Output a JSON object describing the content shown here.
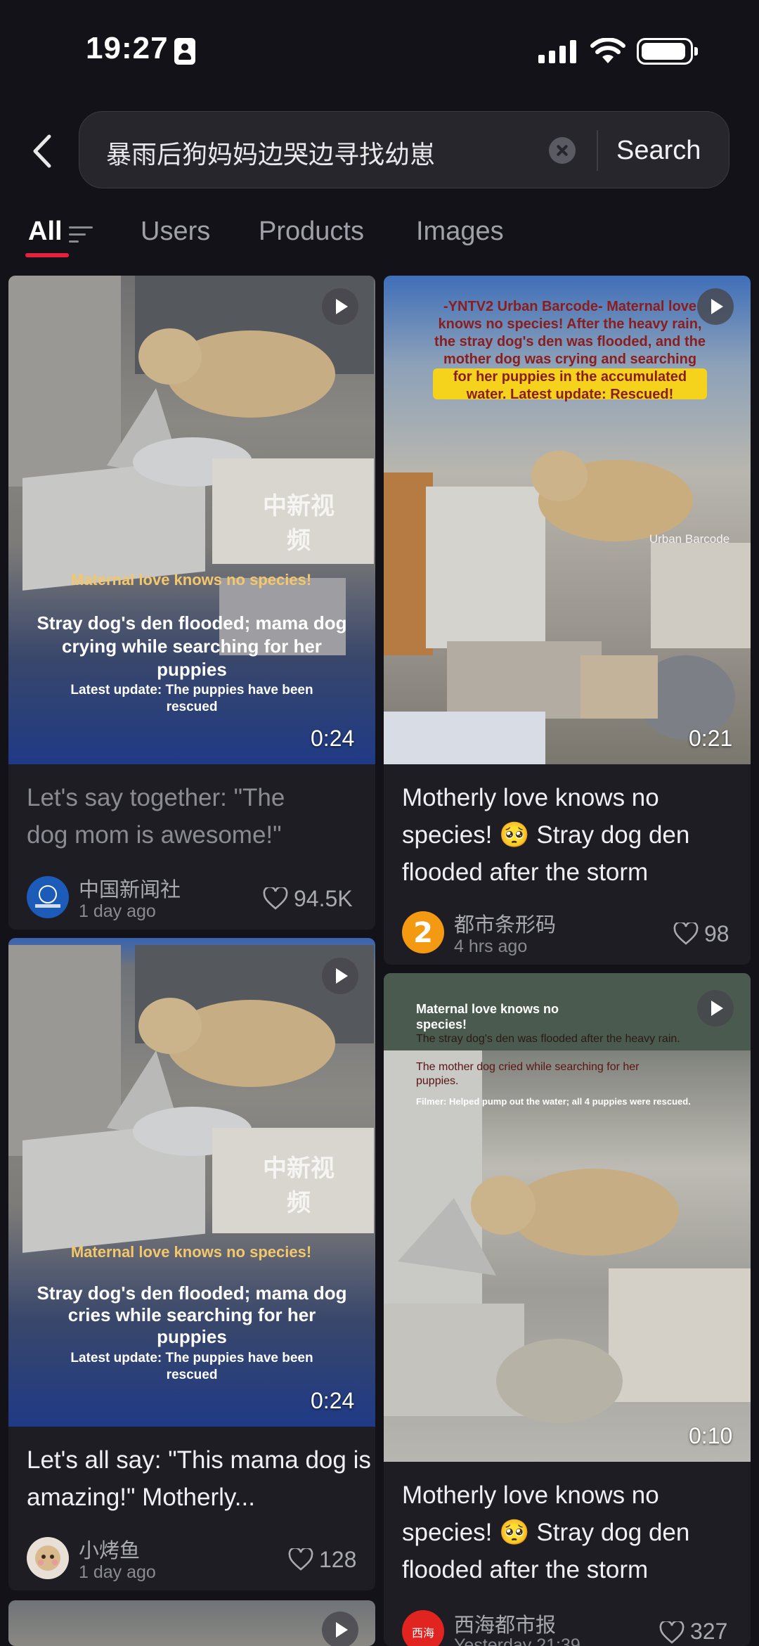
{
  "status_bar": {
    "time": "19:27"
  },
  "search": {
    "query": "暴雨后狗妈妈边哭边寻找幼崽",
    "button_label": "Search"
  },
  "tabs": [
    {
      "label": "All",
      "active": true
    },
    {
      "label": "Users"
    },
    {
      "label": "Products"
    },
    {
      "label": "Images"
    }
  ],
  "cards": [
    {
      "duration": "0:24",
      "overlay": {
        "line1": "Maternal love knows no species!",
        "line2": "Stray dog's den flooded; mama dog crying while searching for her puppies",
        "line3": "Latest update: The puppies have been rescued",
        "watermark": "中新视频"
      },
      "title": "Let's say together: \"The dog mom is awesome!\"",
      "author": "中国新闻社",
      "time": "1 day ago",
      "likes": "94.5K"
    },
    {
      "duration": "0:21",
      "overlay": {
        "text": "-YNTV2 Urban Barcode- Maternal love knows no species! After the heavy rain, the stray dog's den was flooded, and the mother dog was crying and searching for her puppies in the accumulated water. Latest update: Rescued!",
        "watermark": "Urban Barcode"
      },
      "title": "Motherly love knows no species! 🥺 Stray dog den flooded after the storm",
      "author": "都市条形码",
      "time": "4 hrs ago",
      "likes": "98"
    },
    {
      "duration": "0:24",
      "overlay": {
        "line1": "Maternal love knows no species!",
        "line2": "Stray dog's den flooded; mama dog cries while searching for her puppies",
        "line3": "Latest update: The puppies have been rescued",
        "watermark": "中新视频"
      },
      "title": "Let's all say: \"This mama dog is amazing!\" Motherly...",
      "author": "小烤鱼",
      "time": "1 day ago",
      "likes": "128"
    },
    {
      "duration": "0:10",
      "overlay": {
        "line1": "Maternal love knows no species!",
        "line2": "The stray dog's den was flooded after the heavy rain.",
        "line3": "The mother dog cried while searching for her puppies.",
        "line4": "Filmer: Helped pump out the water; all 4 puppies were rescued."
      },
      "title": "Motherly love knows no species! 🥺 Stray dog den flooded after the storm",
      "author": "西海都市报",
      "time": "Yesterday 21:39",
      "likes": "327"
    }
  ],
  "colors": {
    "accent": "#e5223c",
    "background": "#121218",
    "card": "#1d1d23"
  }
}
